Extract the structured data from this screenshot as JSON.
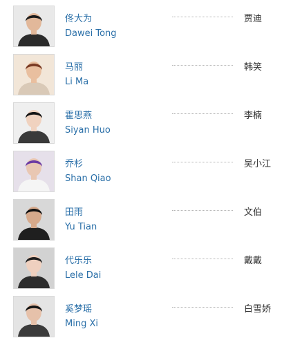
{
  "cast": [
    {
      "name_cn": "佟大为",
      "name_en": "Dawei Tong",
      "role": "贾迪",
      "photo_icon": "actor-photo",
      "bg": "#e9e9e9",
      "skin": "#e2b89a",
      "hair": "#1c1c1c",
      "cloth": "#2b2b2b"
    },
    {
      "name_cn": "马丽",
      "name_en": "Li Ma",
      "role": "韩笑",
      "photo_icon": "actor-photo",
      "bg": "#f2e6d8",
      "skin": "#e9bf9f",
      "hair": "#7a3b24",
      "cloth": "#d9c9b7"
    },
    {
      "name_cn": "霍思燕",
      "name_en": "Siyan Huo",
      "role": "李楠",
      "photo_icon": "actor-photo",
      "bg": "#efefef",
      "skin": "#f0d2bf",
      "hair": "#141414",
      "cloth": "#3a3a3a"
    },
    {
      "name_cn": "乔杉",
      "name_en": "Shan Qiao",
      "role": "吴小江",
      "photo_icon": "actor-photo",
      "bg": "#e6e0ea",
      "skin": "#e9c7b3",
      "hair": "#6b3aa3",
      "cloth": "#f5f5f5"
    },
    {
      "name_cn": "田雨",
      "name_en": "Yu Tian",
      "role": "文伯",
      "photo_icon": "actor-photo",
      "bg": "#d8d8d8",
      "skin": "#d6a98b",
      "hair": "#111111",
      "cloth": "#1f1f1f"
    },
    {
      "name_cn": "代乐乐",
      "name_en": "Lele Dai",
      "role": "戴戴",
      "photo_icon": "actor-photo",
      "bg": "#d2d2d2",
      "skin": "#efd0bf",
      "hair": "#202020",
      "cloth": "#2c2c2c"
    },
    {
      "name_cn": "奚梦瑶",
      "name_en": "Ming Xi",
      "role": "白雪娇",
      "photo_icon": "actor-photo",
      "bg": "#e4e4e4",
      "skin": "#e6c1aa",
      "hair": "#151515",
      "cloth": "#3b3b3b"
    }
  ]
}
